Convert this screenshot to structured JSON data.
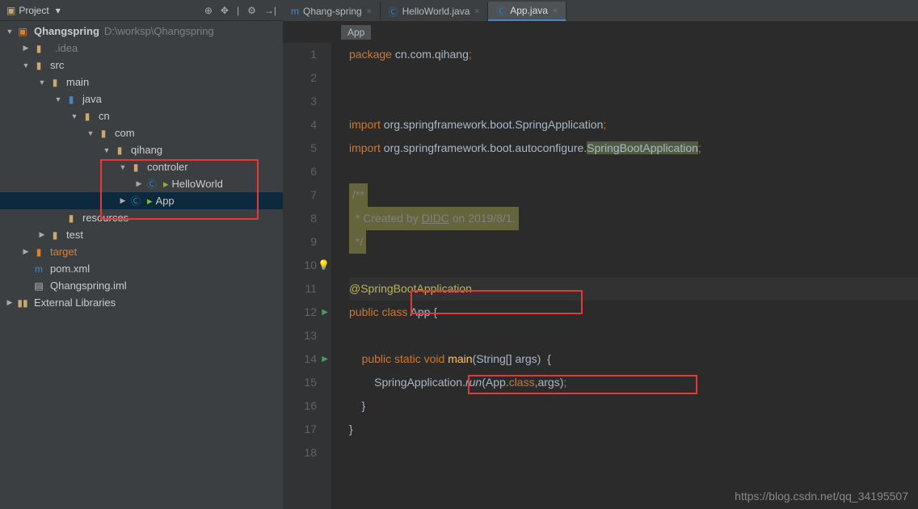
{
  "panel": {
    "title": "Project",
    "project_name": "Qhangspring",
    "project_path": "D:\\worksp\\Qhangspring",
    "external_libraries": "External Libraries"
  },
  "tree": {
    "idea": ".idea",
    "src": "src",
    "main": "main",
    "java": "java",
    "cn": "cn",
    "com": "com",
    "qihang": "qihang",
    "controler": "controler",
    "hello": "HelloWorld",
    "app": "App",
    "resources": "resources",
    "test": "test",
    "target": "target",
    "pom": "pom.xml",
    "iml": "Qhangspring.iml"
  },
  "tabs": {
    "t1": "Qhang-spring",
    "t2": "HelloWorld.java",
    "t3": "App.java"
  },
  "breadcrumb": {
    "main": "App"
  },
  "code": {
    "l1_kw": "package ",
    "l1_rest": "cn.com.qihang",
    "punct_semi": ";",
    "l4_kw": "import ",
    "l4_rest": "org.springframework.boot.SpringApplication",
    "l5_kw": "import ",
    "l5_a": "org.springframework.boot.autoconfigure.",
    "l5_b": "SpringBootApplication",
    "l7_a": "/**",
    "l8_a": " * Created by ",
    "l8_b": "DIDC",
    "l8_c": " on 2019/8/1.",
    "l9_a": " */",
    "l11": "@SpringBootApplication",
    "l12_kw1": "public ",
    "l12_kw2": "class ",
    "l12_name": "App ",
    "l12_brace": "{",
    "l14_pad": "    ",
    "l14_kw1": "public ",
    "l14_kw2": "static ",
    "l14_kw3": "void ",
    "l14_name": "main",
    "l14_arg": "(String[] args)  {",
    "l15_pad": "        ",
    "l15_a": "SpringApplication.",
    "l15_b": "run",
    "l15_c": "(App.",
    "l15_d": "class",
    "l15_e": ",args)",
    "l16": "    }",
    "l17": "}"
  },
  "watermark": "https://blog.csdn.net/qq_34195507"
}
